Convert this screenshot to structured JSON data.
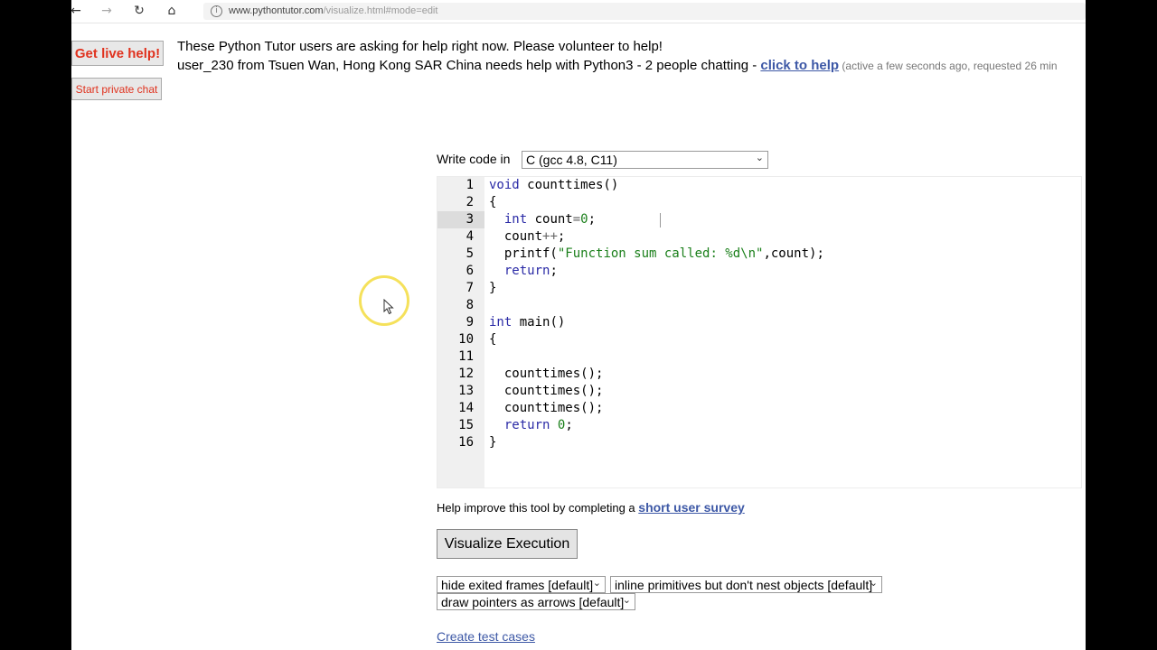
{
  "browser": {
    "nav": {
      "back": "←",
      "forward": "→",
      "refresh": "↻",
      "home": "⌂"
    },
    "url_host": "www.pythontutor.com",
    "url_path": "/visualize.html#mode=edit"
  },
  "live_help": {
    "get_help_label": "Get live help!",
    "private_chat_label": "Start private chat",
    "line1": "These Python Tutor users are asking for help right now. Please volunteer to help!",
    "line2_prefix": "user_230 from Tsuen Wan, Hong Kong SAR China needs help with Python3 - 2 people chatting - ",
    "click_to_help": "click to help",
    "active_note": " (active a few seconds ago, requested 26 min"
  },
  "language": {
    "label": "Write code in",
    "selected": "C (gcc 4.8, C11)"
  },
  "editor": {
    "active_line": 3,
    "line_numbers": [
      "1",
      "2",
      "3",
      "4",
      "5",
      "6",
      "7",
      "8",
      "9",
      "10",
      "11",
      "12",
      "13",
      "14",
      "15",
      "16"
    ],
    "code": {
      "l1_kw": "void",
      "l1_rest": " counttimes()",
      "l2": "{",
      "l3_kw": "int",
      "l3_rest": " count",
      "l3_op": "=",
      "l3_num": "0",
      "l3_end": ";",
      "l4_a": "count",
      "l4_op": "++",
      "l4_end": ";",
      "l5_a": "printf(",
      "l5_str": "\"Function sum called: %d\\n\"",
      "l5_end": ",count);",
      "l6_kw": "return",
      "l6_end": ";",
      "l7": "}",
      "l9_kw": "int",
      "l9_rest": " main()",
      "l10": "{",
      "l12": "counttimes();",
      "l13": "counttimes();",
      "l14": "counttimes();",
      "l15_kw": "return",
      "l15_num": "0",
      "l15_end": ";",
      "l16": "}"
    }
  },
  "survey": {
    "prefix": "Help improve this tool by completing a ",
    "link": "short user survey"
  },
  "visualize_label": "Visualize Execution",
  "options": {
    "frames": "hide exited frames [default]",
    "primitives": "inline primitives but don't nest objects [default]",
    "pointers": "draw pointers as arrows [default]"
  },
  "test_cases_label": "Create test cases",
  "colors": {
    "link": "#3d58a6",
    "help_button_text": "#e0321e",
    "halo": "#f5e15b"
  }
}
